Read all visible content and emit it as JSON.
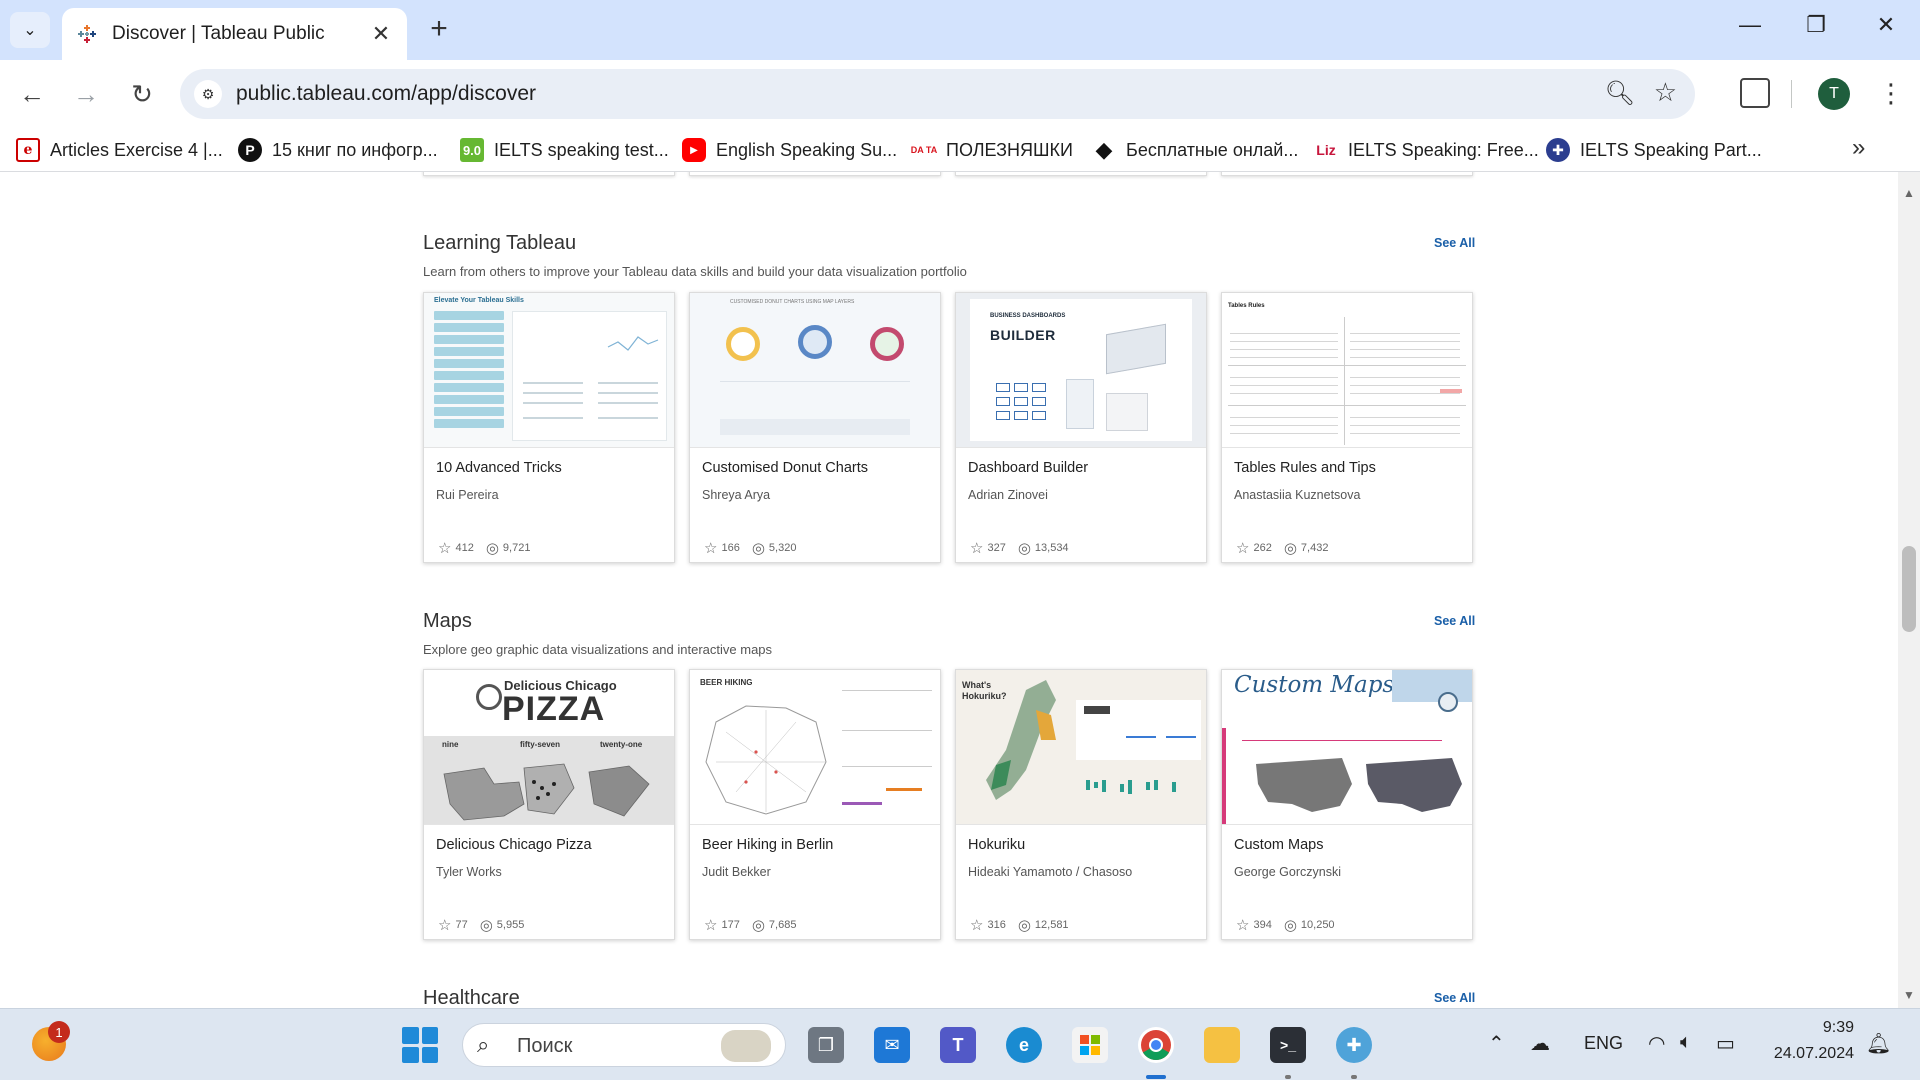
{
  "browser": {
    "tab_title": "Discover | Tableau Public",
    "url": "public.tableau.com/app/discover",
    "profile_initial": "T",
    "bookmarks": [
      {
        "icon": "e-icon",
        "label": "Articles Exercise 4 |..."
      },
      {
        "icon": "p-icon",
        "label": "15 книг по инфогр..."
      },
      {
        "icon": "score-icon",
        "icon_text": "9.0",
        "label": "IELTS speaking test..."
      },
      {
        "icon": "youtube-icon",
        "label": "English Speaking Su..."
      },
      {
        "icon": "da-icon",
        "icon_text": "DA TA",
        "label": "ПОЛЕЗНЯШКИ"
      },
      {
        "icon": "diamond-icon",
        "label": "Бесплатные онлай..."
      },
      {
        "icon": "liz-icon",
        "icon_text": "Liz",
        "label": "IELTS Speaking: Free..."
      },
      {
        "icon": "uk-flag-icon",
        "label": "IELTS Speaking Part..."
      }
    ]
  },
  "sections": [
    {
      "title": "Learning Tableau",
      "description": "Learn from others to improve your Tableau data skills and build your data visualization portfolio",
      "see_all": "See All",
      "cards": [
        {
          "title": "10 Advanced Tricks",
          "author": "Rui Pereira",
          "favorites": "412",
          "views": "9,721",
          "thumb_text": "Elevate Your Tableau Skills"
        },
        {
          "title": "Customised Donut Charts",
          "author": "Shreya Arya",
          "favorites": "166",
          "views": "5,320",
          "thumb_text": "CUSTOMISED DONUT CHARTS USING MAP LAYERS"
        },
        {
          "title": "Dashboard Builder",
          "author": "Adrian Zinovei",
          "favorites": "327",
          "views": "13,534",
          "thumb_text": "BUILDER",
          "thumb_sub": "BUSINESS DASHBOARDS"
        },
        {
          "title": "Tables Rules and Tips",
          "author": "Anastasiia Kuznetsova",
          "favorites": "262",
          "views": "7,432",
          "thumb_text": "Tables Rules"
        }
      ]
    },
    {
      "title": "Maps",
      "description": "Explore geo graphic data visualizations and interactive maps",
      "see_all": "See All",
      "cards": [
        {
          "title": "Delicious Chicago Pizza",
          "author": "Tyler Works",
          "favorites": "77",
          "views": "5,955",
          "thumb_text": "PIZZA",
          "thumb_sub": "Delicious Chicago",
          "thumb_labels": [
            "nine",
            "fifty-seven",
            "twenty-one"
          ]
        },
        {
          "title": "Beer Hiking in Berlin",
          "author": "Judit Bekker",
          "favorites": "177",
          "views": "7,685",
          "thumb_text": "BEER HIKING"
        },
        {
          "title": "Hokuriku",
          "author": "Hideaki Yamamoto / Chasoso",
          "favorites": "316",
          "views": "12,581",
          "thumb_text": "What's Hokuriku?"
        },
        {
          "title": "Custom Maps",
          "author": "George Gorczynski",
          "favorites": "394",
          "views": "10,250",
          "thumb_text": "Custom Maps"
        }
      ]
    },
    {
      "title": "Healthcare",
      "see_all": "See All"
    }
  ],
  "taskbar": {
    "weather_badge": "1",
    "search_placeholder": "Поиск",
    "language": "ENG",
    "time": "9:39",
    "date": "24.07.2024"
  },
  "colors": {
    "tabbar": "#d3e3fd",
    "link": "#1a5fa8",
    "taskbar": "#dde6f1"
  }
}
